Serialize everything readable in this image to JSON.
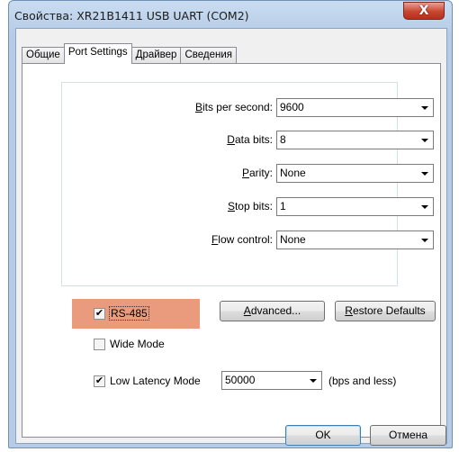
{
  "window": {
    "title": "Свойства: XR21B1411 USB UART (COM2)"
  },
  "tabs": [
    {
      "label": "Общие"
    },
    {
      "label": "Port Settings"
    },
    {
      "label": "Драйвер"
    },
    {
      "label": "Сведения"
    }
  ],
  "settings": {
    "bits_per_second": {
      "label_prefix": "",
      "label_mnemonic": "B",
      "label_rest": "its per second:",
      "value": "9600"
    },
    "data_bits": {
      "label_prefix": "",
      "label_mnemonic": "D",
      "label_rest": "ata bits:",
      "value": "8"
    },
    "parity": {
      "label_prefix": "",
      "label_mnemonic": "P",
      "label_rest": "arity:",
      "value": "None"
    },
    "stop_bits": {
      "label_prefix": "",
      "label_mnemonic": "S",
      "label_rest": "top bits:",
      "value": "1"
    },
    "flow_control": {
      "label_prefix": "",
      "label_mnemonic": "F",
      "label_rest": "low control:",
      "value": "None"
    }
  },
  "options": {
    "rs485": {
      "label": "RS-485",
      "checked": true,
      "check_glyph": "✔"
    },
    "wide_mode": {
      "label": "Wide Mode",
      "checked": false
    },
    "low_latency": {
      "label": "Low Latency Mode",
      "checked": true,
      "check_glyph": "✔",
      "value": "50000",
      "suffix": "(bps and less)"
    }
  },
  "buttons": {
    "advanced_mnemonic": "A",
    "advanced_rest": "dvanced...",
    "restore_mnemonic": "R",
    "restore_rest": "estore Defaults",
    "ok": "OK",
    "cancel": "Отмена",
    "close_glyph": "X"
  },
  "colors": {
    "highlight": "#ea9b7e",
    "close_button": "#c9452f"
  }
}
